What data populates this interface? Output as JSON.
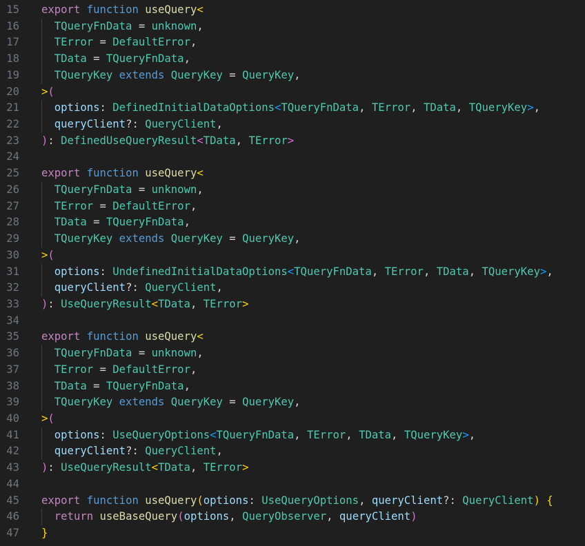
{
  "editor": {
    "theme": {
      "background": "#1f1f1f",
      "line_number": "#6e7681",
      "keyword": "#c586c0",
      "storage": "#569cd6",
      "function": "#dcdcaa",
      "type": "#4ec9b0",
      "variable": "#9cdcfe",
      "punctuation": "#d4d4d4",
      "bracket_1": "#ffd700",
      "bracket_2": "#da70d6",
      "bracket_3": "#179fff"
    },
    "lines": [
      {
        "n": "15",
        "guide": false,
        "tokens": [
          [
            "kw",
            "export"
          ],
          [
            "plain",
            " "
          ],
          [
            "storage",
            "function"
          ],
          [
            "plain",
            " "
          ],
          [
            "fn",
            "useQuery"
          ],
          [
            "b1",
            "<"
          ]
        ]
      },
      {
        "n": "16",
        "guide": true,
        "tokens": [
          [
            "plain",
            "  "
          ],
          [
            "type",
            "TQueryFnData"
          ],
          [
            "plain",
            " = "
          ],
          [
            "type",
            "unknown"
          ],
          [
            "plain",
            ","
          ]
        ]
      },
      {
        "n": "17",
        "guide": true,
        "tokens": [
          [
            "plain",
            "  "
          ],
          [
            "type",
            "TError"
          ],
          [
            "plain",
            " = "
          ],
          [
            "type",
            "DefaultError"
          ],
          [
            "plain",
            ","
          ]
        ]
      },
      {
        "n": "18",
        "guide": true,
        "tokens": [
          [
            "plain",
            "  "
          ],
          [
            "type",
            "TData"
          ],
          [
            "plain",
            " = "
          ],
          [
            "type",
            "TQueryFnData"
          ],
          [
            "plain",
            ","
          ]
        ]
      },
      {
        "n": "19",
        "guide": true,
        "tokens": [
          [
            "plain",
            "  "
          ],
          [
            "type",
            "TQueryKey"
          ],
          [
            "plain",
            " "
          ],
          [
            "storage",
            "extends"
          ],
          [
            "plain",
            " "
          ],
          [
            "type",
            "QueryKey"
          ],
          [
            "plain",
            " = "
          ],
          [
            "type",
            "QueryKey"
          ],
          [
            "plain",
            ","
          ]
        ]
      },
      {
        "n": "20",
        "guide": false,
        "tokens": [
          [
            "b1",
            ">"
          ],
          [
            "b2",
            "("
          ]
        ]
      },
      {
        "n": "21",
        "guide": true,
        "tokens": [
          [
            "plain",
            "  "
          ],
          [
            "var",
            "options"
          ],
          [
            "plain",
            ": "
          ],
          [
            "type",
            "DefinedInitialDataOptions"
          ],
          [
            "b3",
            "<"
          ],
          [
            "type",
            "TQueryFnData"
          ],
          [
            "plain",
            ", "
          ],
          [
            "type",
            "TError"
          ],
          [
            "plain",
            ", "
          ],
          [
            "type",
            "TData"
          ],
          [
            "plain",
            ", "
          ],
          [
            "type",
            "TQueryKey"
          ],
          [
            "b3",
            ">"
          ],
          [
            "plain",
            ","
          ]
        ]
      },
      {
        "n": "22",
        "guide": true,
        "tokens": [
          [
            "plain",
            "  "
          ],
          [
            "var",
            "queryClient"
          ],
          [
            "plain",
            "?: "
          ],
          [
            "type",
            "QueryClient"
          ],
          [
            "plain",
            ","
          ]
        ]
      },
      {
        "n": "23",
        "guide": false,
        "tokens": [
          [
            "b2",
            ")"
          ],
          [
            "plain",
            ": "
          ],
          [
            "type",
            "DefinedUseQueryResult"
          ],
          [
            "b2",
            "<"
          ],
          [
            "type",
            "TData"
          ],
          [
            "plain",
            ", "
          ],
          [
            "type",
            "TError"
          ],
          [
            "b2",
            ">"
          ]
        ]
      },
      {
        "n": "24",
        "guide": false,
        "tokens": []
      },
      {
        "n": "25",
        "guide": false,
        "tokens": [
          [
            "kw",
            "export"
          ],
          [
            "plain",
            " "
          ],
          [
            "storage",
            "function"
          ],
          [
            "plain",
            " "
          ],
          [
            "fn",
            "useQuery"
          ],
          [
            "b1",
            "<"
          ]
        ]
      },
      {
        "n": "26",
        "guide": true,
        "tokens": [
          [
            "plain",
            "  "
          ],
          [
            "type",
            "TQueryFnData"
          ],
          [
            "plain",
            " = "
          ],
          [
            "type",
            "unknown"
          ],
          [
            "plain",
            ","
          ]
        ]
      },
      {
        "n": "27",
        "guide": true,
        "tokens": [
          [
            "plain",
            "  "
          ],
          [
            "type",
            "TError"
          ],
          [
            "plain",
            " = "
          ],
          [
            "type",
            "DefaultError"
          ],
          [
            "plain",
            ","
          ]
        ]
      },
      {
        "n": "28",
        "guide": true,
        "tokens": [
          [
            "plain",
            "  "
          ],
          [
            "type",
            "TData"
          ],
          [
            "plain",
            " = "
          ],
          [
            "type",
            "TQueryFnData"
          ],
          [
            "plain",
            ","
          ]
        ]
      },
      {
        "n": "29",
        "guide": true,
        "tokens": [
          [
            "plain",
            "  "
          ],
          [
            "type",
            "TQueryKey"
          ],
          [
            "plain",
            " "
          ],
          [
            "storage",
            "extends"
          ],
          [
            "plain",
            " "
          ],
          [
            "type",
            "QueryKey"
          ],
          [
            "plain",
            " = "
          ],
          [
            "type",
            "QueryKey"
          ],
          [
            "plain",
            ","
          ]
        ]
      },
      {
        "n": "30",
        "guide": false,
        "tokens": [
          [
            "b1",
            ">"
          ],
          [
            "b2",
            "("
          ]
        ]
      },
      {
        "n": "31",
        "guide": true,
        "tokens": [
          [
            "plain",
            "  "
          ],
          [
            "var",
            "options"
          ],
          [
            "plain",
            ": "
          ],
          [
            "type",
            "UndefinedInitialDataOptions"
          ],
          [
            "b3",
            "<"
          ],
          [
            "type",
            "TQueryFnData"
          ],
          [
            "plain",
            ", "
          ],
          [
            "type",
            "TError"
          ],
          [
            "plain",
            ", "
          ],
          [
            "type",
            "TData"
          ],
          [
            "plain",
            ", "
          ],
          [
            "type",
            "TQueryKey"
          ],
          [
            "b3",
            ">"
          ],
          [
            "plain",
            ","
          ]
        ]
      },
      {
        "n": "32",
        "guide": true,
        "tokens": [
          [
            "plain",
            "  "
          ],
          [
            "var",
            "queryClient"
          ],
          [
            "plain",
            "?: "
          ],
          [
            "type",
            "QueryClient"
          ],
          [
            "plain",
            ","
          ]
        ]
      },
      {
        "n": "33",
        "guide": false,
        "tokens": [
          [
            "b2",
            ")"
          ],
          [
            "plain",
            ": "
          ],
          [
            "type",
            "UseQueryResult"
          ],
          [
            "b1",
            "<"
          ],
          [
            "type",
            "TData"
          ],
          [
            "plain",
            ", "
          ],
          [
            "type",
            "TError"
          ],
          [
            "b1",
            ">"
          ]
        ]
      },
      {
        "n": "34",
        "guide": false,
        "tokens": []
      },
      {
        "n": "35",
        "guide": false,
        "tokens": [
          [
            "kw",
            "export"
          ],
          [
            "plain",
            " "
          ],
          [
            "storage",
            "function"
          ],
          [
            "plain",
            " "
          ],
          [
            "fn",
            "useQuery"
          ],
          [
            "b1",
            "<"
          ]
        ]
      },
      {
        "n": "36",
        "guide": true,
        "tokens": [
          [
            "plain",
            "  "
          ],
          [
            "type",
            "TQueryFnData"
          ],
          [
            "plain",
            " = "
          ],
          [
            "type",
            "unknown"
          ],
          [
            "plain",
            ","
          ]
        ]
      },
      {
        "n": "37",
        "guide": true,
        "tokens": [
          [
            "plain",
            "  "
          ],
          [
            "type",
            "TError"
          ],
          [
            "plain",
            " = "
          ],
          [
            "type",
            "DefaultError"
          ],
          [
            "plain",
            ","
          ]
        ]
      },
      {
        "n": "38",
        "guide": true,
        "tokens": [
          [
            "plain",
            "  "
          ],
          [
            "type",
            "TData"
          ],
          [
            "plain",
            " = "
          ],
          [
            "type",
            "TQueryFnData"
          ],
          [
            "plain",
            ","
          ]
        ]
      },
      {
        "n": "39",
        "guide": true,
        "tokens": [
          [
            "plain",
            "  "
          ],
          [
            "type",
            "TQueryKey"
          ],
          [
            "plain",
            " "
          ],
          [
            "storage",
            "extends"
          ],
          [
            "plain",
            " "
          ],
          [
            "type",
            "QueryKey"
          ],
          [
            "plain",
            " = "
          ],
          [
            "type",
            "QueryKey"
          ],
          [
            "plain",
            ","
          ]
        ]
      },
      {
        "n": "40",
        "guide": false,
        "tokens": [
          [
            "b1",
            ">"
          ],
          [
            "b2",
            "("
          ]
        ]
      },
      {
        "n": "41",
        "guide": true,
        "tokens": [
          [
            "plain",
            "  "
          ],
          [
            "var",
            "options"
          ],
          [
            "plain",
            ": "
          ],
          [
            "type",
            "UseQueryOptions"
          ],
          [
            "b3",
            "<"
          ],
          [
            "type",
            "TQueryFnData"
          ],
          [
            "plain",
            ", "
          ],
          [
            "type",
            "TError"
          ],
          [
            "plain",
            ", "
          ],
          [
            "type",
            "TData"
          ],
          [
            "plain",
            ", "
          ],
          [
            "type",
            "TQueryKey"
          ],
          [
            "b3",
            ">"
          ],
          [
            "plain",
            ","
          ]
        ]
      },
      {
        "n": "42",
        "guide": true,
        "tokens": [
          [
            "plain",
            "  "
          ],
          [
            "var",
            "queryClient"
          ],
          [
            "plain",
            "?: "
          ],
          [
            "type",
            "QueryClient"
          ],
          [
            "plain",
            ","
          ]
        ]
      },
      {
        "n": "43",
        "guide": false,
        "tokens": [
          [
            "b2",
            ")"
          ],
          [
            "plain",
            ": "
          ],
          [
            "type",
            "UseQueryResult"
          ],
          [
            "b1",
            "<"
          ],
          [
            "type",
            "TData"
          ],
          [
            "plain",
            ", "
          ],
          [
            "type",
            "TError"
          ],
          [
            "b1",
            ">"
          ]
        ]
      },
      {
        "n": "44",
        "guide": false,
        "tokens": []
      },
      {
        "n": "45",
        "guide": false,
        "tokens": [
          [
            "kw",
            "export"
          ],
          [
            "plain",
            " "
          ],
          [
            "storage",
            "function"
          ],
          [
            "plain",
            " "
          ],
          [
            "fn",
            "useQuery"
          ],
          [
            "b1",
            "("
          ],
          [
            "var",
            "options"
          ],
          [
            "plain",
            ": "
          ],
          [
            "type",
            "UseQueryOptions"
          ],
          [
            "plain",
            ", "
          ],
          [
            "var",
            "queryClient"
          ],
          [
            "plain",
            "?: "
          ],
          [
            "type",
            "QueryClient"
          ],
          [
            "b1",
            ")"
          ],
          [
            "plain",
            " "
          ],
          [
            "b1",
            "{"
          ]
        ]
      },
      {
        "n": "46",
        "guide": true,
        "tokens": [
          [
            "plain",
            "  "
          ],
          [
            "kw",
            "return"
          ],
          [
            "plain",
            " "
          ],
          [
            "fn",
            "useBaseQuery"
          ],
          [
            "b2",
            "("
          ],
          [
            "var",
            "options"
          ],
          [
            "plain",
            ", "
          ],
          [
            "type",
            "QueryObserver"
          ],
          [
            "plain",
            ", "
          ],
          [
            "var",
            "queryClient"
          ],
          [
            "b2",
            ")"
          ]
        ]
      },
      {
        "n": "47",
        "guide": false,
        "tokens": [
          [
            "b1",
            "}"
          ]
        ]
      }
    ]
  }
}
